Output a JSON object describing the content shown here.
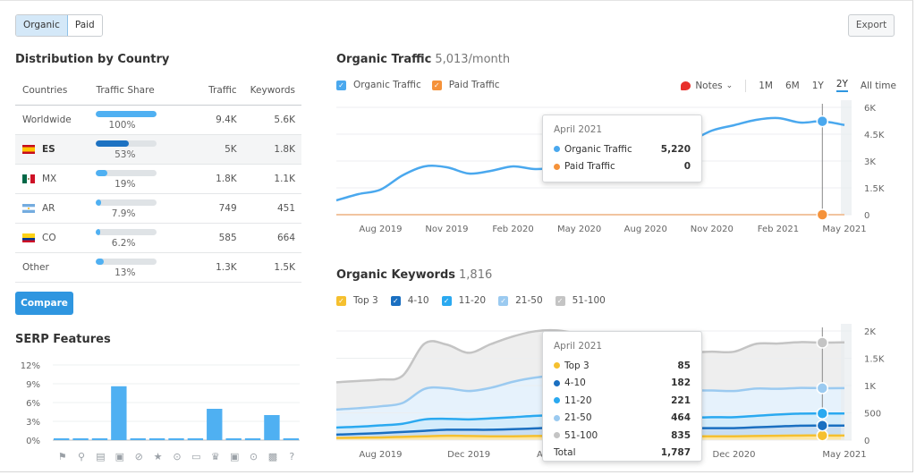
{
  "toggle": {
    "options": [
      "Organic",
      "Paid"
    ],
    "active": "Organic"
  },
  "export_label": "Export",
  "distribution": {
    "title": "Distribution by Country",
    "columns": [
      "Countries",
      "Traffic Share",
      "Traffic",
      "Keywords"
    ],
    "rows": [
      {
        "country": "Worldwide",
        "flag": null,
        "share": "100%",
        "share_value": 1.0,
        "traffic": "9.4K",
        "keywords": "5.6K",
        "highlight": false,
        "linked": false
      },
      {
        "country": "ES",
        "flag": "es",
        "share": "53%",
        "share_value": 0.53,
        "traffic": "5K",
        "keywords": "1.8K",
        "highlight": true,
        "linked": true
      },
      {
        "country": "MX",
        "flag": "mx",
        "share": "19%",
        "share_value": 0.19,
        "traffic": "1.8K",
        "keywords": "1.1K",
        "highlight": false,
        "linked": true
      },
      {
        "country": "AR",
        "flag": "ar",
        "share": "7.9%",
        "share_value": 0.079,
        "traffic": "749",
        "keywords": "451",
        "highlight": false,
        "linked": true
      },
      {
        "country": "CO",
        "flag": "co",
        "share": "6.2%",
        "share_value": 0.062,
        "traffic": "585",
        "keywords": "664",
        "highlight": false,
        "linked": true
      },
      {
        "country": "Other",
        "flag": null,
        "share": "13%",
        "share_value": 0.13,
        "traffic": "1.3K",
        "keywords": "1.5K",
        "highlight": false,
        "linked": false
      }
    ],
    "compare_label": "Compare"
  },
  "serp": {
    "title": "SERP Features",
    "icons": [
      "graduation-cap-icon",
      "map-pin-icon",
      "news-icon",
      "image-icon",
      "link-icon",
      "star-icon",
      "video-play-icon",
      "video-icon",
      "crown-icon",
      "image-pack-icon",
      "play-circle-icon",
      "question-box-icon",
      "question-circle-icon"
    ]
  },
  "organic_traffic": {
    "title": "Organic Traffic",
    "subtitle": "5,013/month",
    "legend": [
      {
        "label": "Organic Traffic",
        "color": "#4aa8ee",
        "checked": true
      },
      {
        "label": "Paid Traffic",
        "color": "#f5923a",
        "checked": true
      }
    ],
    "notes_label": "Notes",
    "ranges": [
      "1M",
      "6M",
      "1Y",
      "2Y",
      "All time"
    ],
    "active_range": "2Y",
    "tooltip": {
      "date": "April 2021",
      "rows": [
        {
          "label": "Organic Traffic",
          "value": "5,220",
          "color": "#4aa8ee"
        },
        {
          "label": "Paid Traffic",
          "value": "0",
          "color": "#f5923a"
        }
      ]
    }
  },
  "organic_keywords": {
    "title": "Organic Keywords",
    "subtitle": "1,816",
    "legend": [
      {
        "label": "Top 3",
        "color": "#f5c02f",
        "checked": true
      },
      {
        "label": "4-10",
        "color": "#1a6fc1",
        "checked": true
      },
      {
        "label": "11-20",
        "color": "#2aa9f0",
        "checked": true
      },
      {
        "label": "21-50",
        "color": "#9bcaf0",
        "checked": true
      },
      {
        "label": "51-100",
        "color": "#c4c4c4",
        "checked": true
      }
    ],
    "tooltip": {
      "date": "April 2021",
      "rows": [
        {
          "label": "Top 3",
          "value": "85",
          "color": "#f5c02f"
        },
        {
          "label": "4-10",
          "value": "182",
          "color": "#1a6fc1"
        },
        {
          "label": "11-20",
          "value": "221",
          "color": "#2aa9f0"
        },
        {
          "label": "21-50",
          "value": "464",
          "color": "#9bcaf0"
        },
        {
          "label": "51-100",
          "value": "835",
          "color": "#c4c4c4"
        }
      ],
      "total_label": "Total",
      "total_value": "1,787"
    }
  },
  "chart_data": [
    {
      "type": "bar",
      "title": "SERP Features",
      "categories": [
        "Knowledge panel",
        "Local pack",
        "Featured snippet",
        "Image",
        "Sitelinks",
        "Reviews",
        "Video",
        "Featured video",
        "Top stories",
        "Image pack",
        "Video carousel",
        "People also ask",
        "FAQ"
      ],
      "values": [
        0.2,
        0.2,
        0.2,
        8.6,
        0.2,
        0.2,
        0.2,
        0.2,
        5.0,
        0.2,
        0.2,
        4.0,
        0.2
      ],
      "ylabel": "",
      "yticks": [
        "0%",
        "3%",
        "6%",
        "9%",
        "12%"
      ],
      "ylim": [
        0,
        12
      ],
      "grid": true
    },
    {
      "type": "line",
      "title": "Organic Traffic",
      "x": [
        "Jun 2019",
        "Jul 2019",
        "Aug 2019",
        "Sep 2019",
        "Oct 2019",
        "Nov 2019",
        "Dec 2019",
        "Jan 2020",
        "Feb 2020",
        "Mar 2020",
        "Apr 2020",
        "May 2020",
        "Jun 2020",
        "Jul 2020",
        "Aug 2020",
        "Sep 2020",
        "Oct 2020",
        "Nov 2020",
        "Dec 2020",
        "Jan 2021",
        "Feb 2021",
        "Mar 2021",
        "Apr 2021",
        "May 2021"
      ],
      "xticks": [
        "Aug 2019",
        "Nov 2019",
        "Feb 2020",
        "May 2020",
        "Aug 2020",
        "Nov 2020",
        "Feb 2021",
        "May 2021"
      ],
      "series": [
        {
          "name": "Organic Traffic",
          "color": "#4aa8ee",
          "values": [
            800,
            1150,
            1400,
            2200,
            2700,
            2650,
            2300,
            2450,
            2700,
            2550,
            2650,
            2900,
            3050,
            3250,
            3400,
            3700,
            4100,
            4700,
            5000,
            5300,
            5400,
            5150,
            5220,
            5013
          ]
        },
        {
          "name": "Paid Traffic",
          "color": "#f5923a",
          "values": [
            0,
            0,
            0,
            0,
            0,
            0,
            0,
            0,
            0,
            0,
            0,
            0,
            0,
            0,
            0,
            0,
            0,
            0,
            0,
            0,
            0,
            0,
            0,
            0
          ]
        }
      ],
      "yticks": [
        "0",
        "1.5K",
        "3K",
        "4.5K",
        "6K"
      ],
      "ylim": [
        0,
        6000
      ],
      "grid": true,
      "highlight": "Apr 2021"
    },
    {
      "type": "area",
      "title": "Organic Keywords",
      "x": [
        "Jun 2019",
        "Jul 2019",
        "Aug 2019",
        "Sep 2019",
        "Oct 2019",
        "Nov 2019",
        "Dec 2019",
        "Jan 2020",
        "Feb 2020",
        "Mar 2020",
        "Apr 2020",
        "May 2020",
        "Jun 2020",
        "Jul 2020",
        "Aug 2020",
        "Sep 2020",
        "Oct 2020",
        "Nov 2020",
        "Dec 2020",
        "Jan 2021",
        "Feb 2021",
        "Mar 2021",
        "Apr 2021",
        "May 2021"
      ],
      "xticks": [
        "Aug 2019",
        "Dec 2019",
        "Apr 2020",
        "Aug 2020",
        "Dec 2020",
        "May 2021"
      ],
      "stacked": true,
      "series": [
        {
          "name": "Top 3",
          "color": "#f5c02f",
          "values": [
            40,
            45,
            50,
            60,
            70,
            80,
            75,
            70,
            70,
            75,
            80,
            80,
            80,
            75,
            70,
            70,
            70,
            70,
            70,
            75,
            80,
            85,
            85,
            85
          ]
        },
        {
          "name": "4-10",
          "color": "#1a6fc1",
          "values": [
            60,
            70,
            80,
            90,
            100,
            110,
            115,
            120,
            130,
            140,
            150,
            155,
            160,
            160,
            155,
            150,
            150,
            150,
            150,
            160,
            170,
            180,
            182,
            182
          ]
        },
        {
          "name": "11-20",
          "color": "#2aa9f0",
          "values": [
            130,
            130,
            140,
            150,
            210,
            200,
            190,
            210,
            220,
            230,
            230,
            230,
            220,
            210,
            200,
            190,
            190,
            200,
            200,
            210,
            220,
            221,
            221,
            221
          ]
        },
        {
          "name": "21-50",
          "color": "#9bcaf0",
          "values": [
            330,
            340,
            350,
            380,
            560,
            560,
            520,
            560,
            650,
            700,
            720,
            700,
            650,
            600,
            560,
            520,
            500,
            490,
            480,
            500,
            470,
            470,
            464,
            464
          ]
        },
        {
          "name": "51-100",
          "color": "#c4c4c4",
          "values": [
            500,
            500,
            490,
            500,
            830,
            800,
            700,
            800,
            830,
            850,
            830,
            780,
            760,
            740,
            720,
            700,
            700,
            710,
            720,
            820,
            830,
            840,
            835,
            840
          ]
        }
      ],
      "yticks": [
        "0",
        "500",
        "1K",
        "1.5K",
        "2K"
      ],
      "ylim": [
        0,
        2000
      ],
      "grid": true,
      "highlight": "Apr 2021"
    }
  ]
}
